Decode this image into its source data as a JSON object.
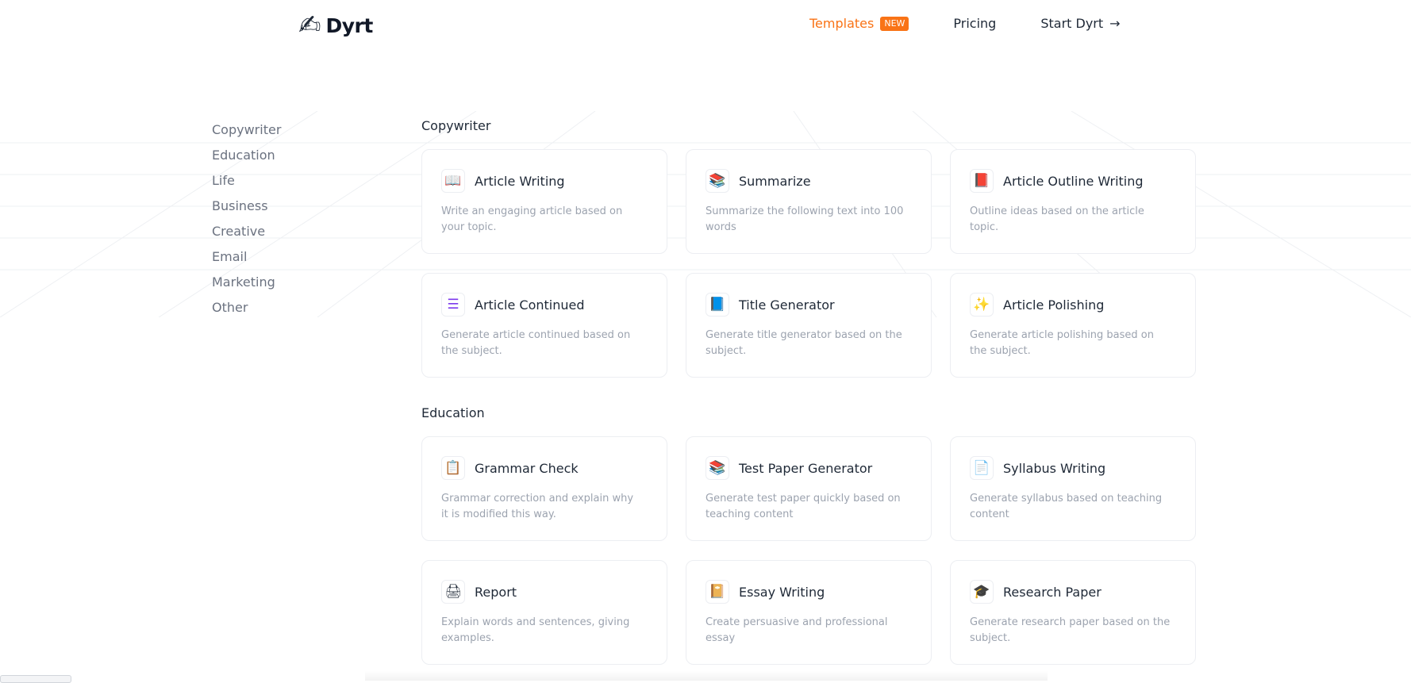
{
  "brand": {
    "name": "Dyrt",
    "icon": "writing-hand-icon"
  },
  "nav": {
    "templates": "Templates",
    "templates_badge": "NEW",
    "pricing": "Pricing",
    "start": "Start Dyrt",
    "start_icon": "arrow-right-icon"
  },
  "colors": {
    "accent": "#f97316"
  },
  "sidebar": {
    "items": [
      {
        "label": "Copywriter"
      },
      {
        "label": "Education"
      },
      {
        "label": "Life"
      },
      {
        "label": "Business"
      },
      {
        "label": "Creative"
      },
      {
        "label": "Email"
      },
      {
        "label": "Marketing"
      },
      {
        "label": "Other"
      }
    ]
  },
  "sections": [
    {
      "title": "Copywriter",
      "cards": [
        {
          "icon": "📖",
          "icon_name": "open-book-icon",
          "title": "Article Writing",
          "desc": "Write an engaging article based on your topic."
        },
        {
          "icon": "📚",
          "icon_name": "layers-icon",
          "title": "Summarize",
          "desc": "Summarize the following text into 100 words"
        },
        {
          "icon": "📕",
          "icon_name": "notebook-icon",
          "title": "Article Outline Writing",
          "desc": "Outline ideas based on the article topic."
        },
        {
          "icon": "☰",
          "icon_name": "stack-icon",
          "title": "Article Continued",
          "desc": "Generate article continued based on the subject."
        },
        {
          "icon": "📘",
          "icon_name": "blue-book-icon",
          "title": "Title Generator",
          "desc": "Generate title generator based on the subject."
        },
        {
          "icon": "✨",
          "icon_name": "sparkles-icon",
          "title": "Article Polishing",
          "desc": "Generate article polishing based on the subject."
        }
      ]
    },
    {
      "title": "Education",
      "cards": [
        {
          "icon": "📋",
          "icon_name": "clipboard-icon",
          "title": "Grammar Check",
          "desc": "Grammar correction and explain why it is modified this way."
        },
        {
          "icon": "📚",
          "icon_name": "books-icon",
          "title": "Test Paper Generator",
          "desc": "Generate test paper quickly based on teaching content"
        },
        {
          "icon": "📄",
          "icon_name": "document-icon",
          "title": "Syllabus Writing",
          "desc": "Generate syllabus based on teaching content"
        },
        {
          "icon": "🖨",
          "icon_name": "printer-icon",
          "title": "Report",
          "desc": "Explain words and sentences, giving examples."
        },
        {
          "icon": "📔",
          "icon_name": "notebook-blue-icon",
          "title": "Essay Writing",
          "desc": "Create persuasive and professional essay"
        },
        {
          "icon": "🎓",
          "icon_name": "graduation-cap-icon",
          "title": "Research Paper",
          "desc": "Generate research paper based on the subject."
        }
      ]
    }
  ]
}
